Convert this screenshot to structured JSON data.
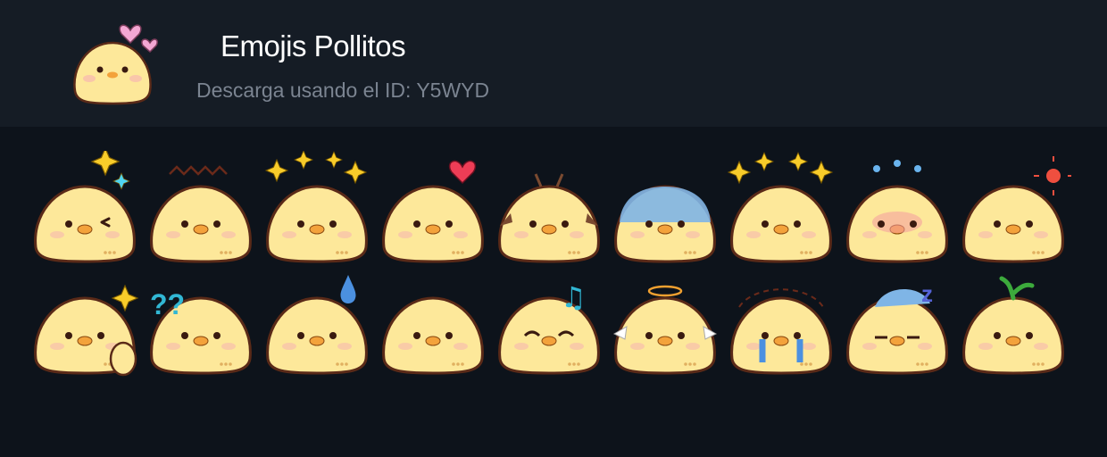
{
  "pack": {
    "title": "Emojis Pollitos",
    "subtitle": "Descarga usando el ID: Y5WYD",
    "icon": "chick-hearts-icon"
  },
  "colors": {
    "header_bg": "#151c25",
    "page_bg": "#0d131b",
    "chick_body": "#fde89a",
    "outline": "#5a2a18",
    "beak": "#f3a23b"
  },
  "emojis": [
    {
      "name": "chick-wink-star-icon"
    },
    {
      "name": "chick-angry-tuft-icon"
    },
    {
      "name": "chick-sparkle-eyes-icon"
    },
    {
      "name": "chick-heart-icon"
    },
    {
      "name": "chick-devil-bat-icon"
    },
    {
      "name": "chick-gloomy-blue-icon"
    },
    {
      "name": "chick-sparkles-icon"
    },
    {
      "name": "chick-embarrassed-icon"
    },
    {
      "name": "chick-sunny-icon"
    },
    {
      "name": "chick-thumbs-up-icon"
    },
    {
      "name": "chick-question-marks-icon"
    },
    {
      "name": "chick-sweat-drop-icon"
    },
    {
      "name": "chick-plain-icon"
    },
    {
      "name": "chick-happy-music-icon"
    },
    {
      "name": "chick-angel-icon"
    },
    {
      "name": "chick-crying-icon"
    },
    {
      "name": "chick-sleeping-icon"
    },
    {
      "name": "chick-sprout-icon"
    }
  ]
}
